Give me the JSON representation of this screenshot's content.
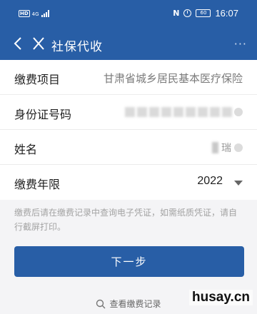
{
  "status_bar": {
    "network_badge": "HD",
    "network_type": "4G",
    "nfc": "N",
    "battery": "60",
    "time": "16:07"
  },
  "nav": {
    "back_icon": "chevron-left-icon",
    "close_icon": "close-icon",
    "title": "社保代收",
    "more_icon": "more-dots-icon",
    "more": "···"
  },
  "form": {
    "item": {
      "label": "缴费项目",
      "value": "甘肃省城乡居民基本医疗保险"
    },
    "id_number": {
      "label": "身份证号码"
    },
    "name": {
      "label": "姓名",
      "visible_char": "瑞"
    },
    "year": {
      "label": "缴费年限",
      "value": "2022"
    }
  },
  "notice": "缴费后请在缴费记录中查询电子凭证，如需纸质凭证，请自行截屏打印。",
  "next_button": "下一步",
  "records_link": "查看缴费记录",
  "watermark": "husay.cn",
  "colors": {
    "brand": "#285ea6",
    "background": "#f4f4f6"
  }
}
